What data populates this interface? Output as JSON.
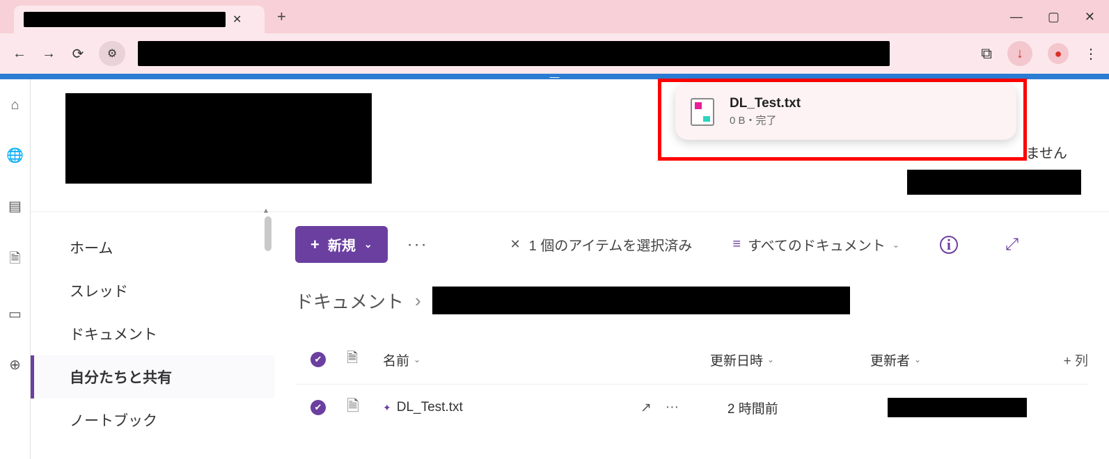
{
  "download_popup": {
    "filename": "DL_Test.txt",
    "meta": "0 B・完了"
  },
  "truncated_header_text": "ません",
  "sidebar": {
    "items": [
      {
        "label": "ホーム"
      },
      {
        "label": "スレッド"
      },
      {
        "label": "ドキュメント"
      },
      {
        "label": "自分たちと共有"
      },
      {
        "label": "ノートブック"
      }
    ]
  },
  "toolbar": {
    "new_label": "新規",
    "selection_text": "1 個のアイテムを選択済み",
    "view_label": "すべてのドキュメント"
  },
  "breadcrumb": {
    "root": "ドキュメント"
  },
  "table": {
    "headers": {
      "name": "名前",
      "updated": "更新日時",
      "updater": "更新者",
      "addcol": "+ 列"
    },
    "rows": [
      {
        "name": "DL_Test.txt",
        "updated": "2 時間前"
      }
    ]
  }
}
